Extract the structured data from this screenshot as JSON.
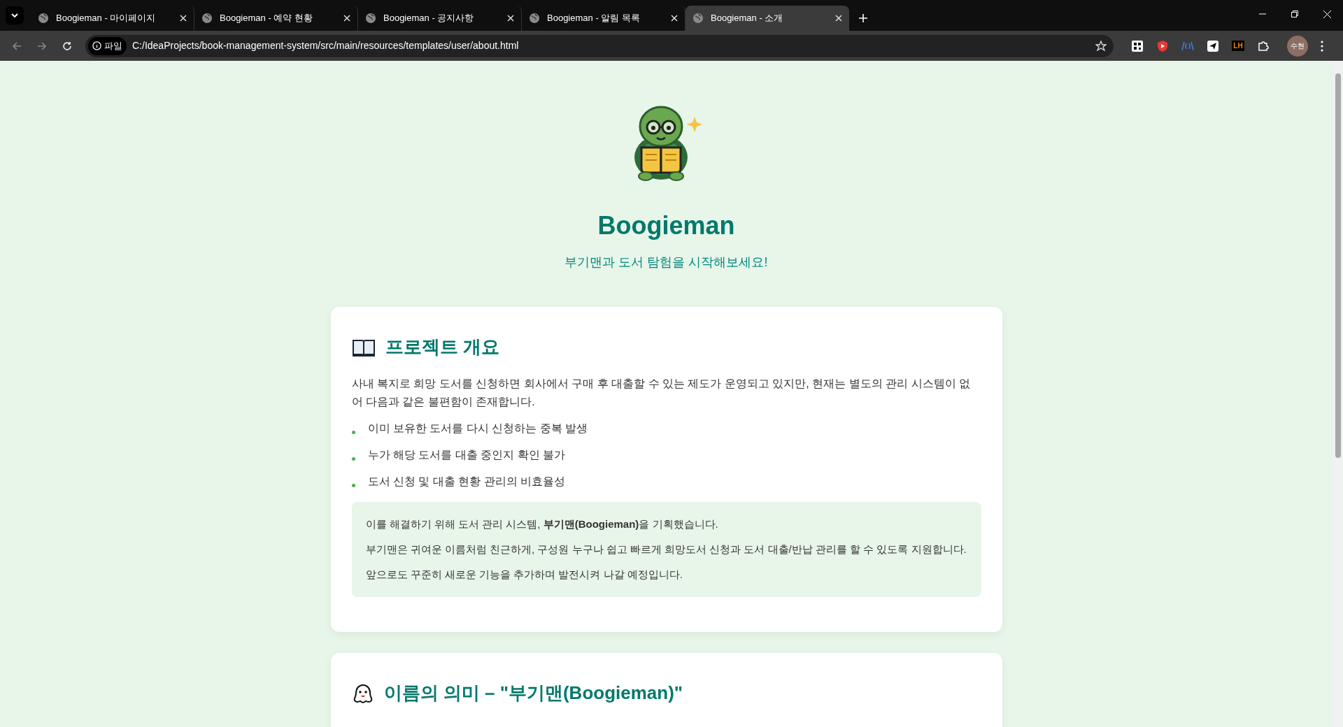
{
  "browser": {
    "tabs": [
      {
        "title": "Boogieman - 마이페이지",
        "selected": false
      },
      {
        "title": "Boogieman - 예약 현황",
        "selected": false
      },
      {
        "title": "Boogieman - 공지사항",
        "selected": false
      },
      {
        "title": "Boogieman - 알림 목록",
        "selected": false
      },
      {
        "title": "Boogieman - 소개",
        "selected": true
      }
    ],
    "address": {
      "badge": "파일",
      "url": "C:/IdeaProjects/book-management-system/src/main/resources/templates/user/about.html"
    },
    "extension_label": "LH",
    "profile": "수현"
  },
  "hero": {
    "title": "Boogieman",
    "subtitle": "부기맨과 도서 탐험을 시작해보세요!"
  },
  "sections": [
    {
      "kind": "overview",
      "title": "프로젝트 개요",
      "intro": "사내 복지로 희망 도서를 신청하면 회사에서 구매 후 대출할 수 있는 제도가 운영되고 있지만, 현재는 별도의 관리 시스템이 없어 다음과 같은 불편함이 존재합니다.",
      "bullets": [
        "이미 보유한 도서를 다시 신청하는 중복 발생",
        "누가 해당 도서를 대출 중인지 확인 불가",
        "도서 신청 및 대출 현황 관리의 비효율성"
      ],
      "note": [
        "이를 해결하기 위해 도서 관리 시스템, **부기맨(Boogieman)**을 기획했습니다.",
        "부기맨은 귀여운 이름처럼 친근하게, 구성원 누구나 쉽고 빠르게 희망도서 신청과 도서 대출/반납 관리를 할 수 있도록 지원합니다.",
        "앞으로도 꾸준히 새로운 기능을 추가하며 발전시켜 나갈 예정입니다."
      ]
    },
    {
      "kind": "name",
      "title": "이름의 의미 – \"부기맨(Boogieman)\""
    }
  ]
}
